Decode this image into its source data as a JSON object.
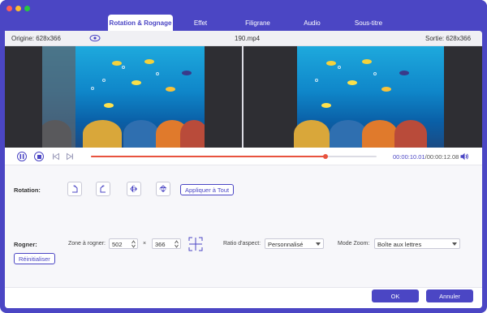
{
  "tabs": [
    {
      "label": "Rotation & Rognage",
      "active": true
    },
    {
      "label": "Effet",
      "active": false
    },
    {
      "label": "Filigrane",
      "active": false
    },
    {
      "label": "Audio",
      "active": false
    },
    {
      "label": "Sous-titre",
      "active": false
    }
  ],
  "info": {
    "origin_label": "Origine: 628x366",
    "filename": "190.mp4",
    "output_label": "Sortie: 628x366"
  },
  "player": {
    "progress": 0.82,
    "current_time": "00:00:10.01",
    "total_time": "/00:00:12.08"
  },
  "rotation": {
    "label": "Rotation:",
    "apply_all_label": "Appliquer à Tout",
    "buttons": [
      "rotate-left-icon",
      "rotate-right-icon",
      "flip-horizontal-icon",
      "flip-vertical-icon"
    ]
  },
  "crop": {
    "label": "Rogner:",
    "zone_label": "Zone à rogner:",
    "width": "502",
    "times": "×",
    "height": "366",
    "aspect_label": "Ratio d'aspect:",
    "aspect_value": "Personnalisé",
    "zoom_label": "Mode Zoom:",
    "zoom_value": "Boîte aux lettres",
    "reset_label": "Réinitialiser"
  },
  "footer": {
    "ok_label": "OK",
    "cancel_label": "Annuler"
  },
  "colors": {
    "accent": "#4b46c4",
    "progress": "#e8533f"
  }
}
